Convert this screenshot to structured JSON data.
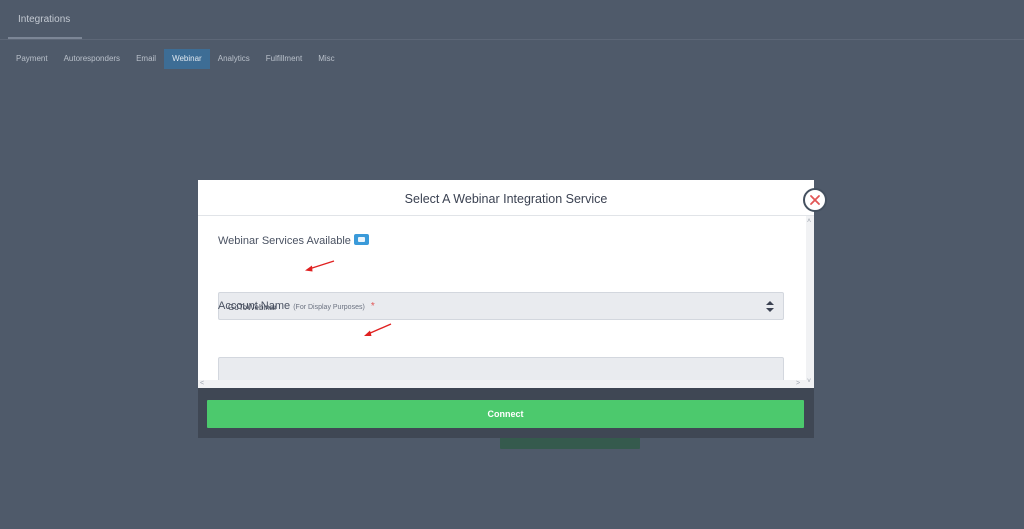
{
  "page": {
    "title": "Integrations",
    "tabs": [
      {
        "label": "Payment",
        "active": false
      },
      {
        "label": "Autoresponders",
        "active": false
      },
      {
        "label": "Email",
        "active": false
      },
      {
        "label": "Webinar",
        "active": true
      },
      {
        "label": "Analytics",
        "active": false
      },
      {
        "label": "Fulfillment",
        "active": false
      },
      {
        "label": "Misc",
        "active": false
      }
    ]
  },
  "modal": {
    "title": "Select A Webinar Integration Service",
    "services_label": "Webinar Services Available",
    "service_selected": "GoToWebinar",
    "account_label": "Account Name",
    "account_hint": "(For Display Purposes)",
    "required_mark": "*",
    "account_value": "",
    "connect_label": "Connect"
  },
  "icons": {
    "close": "close-icon",
    "info": "info-icon",
    "select_arrows": "select-arrows-icon",
    "annotation": "red-arrow-icon"
  },
  "colors": {
    "accent_green": "#4cc96d",
    "active_tab": "#3d6d95",
    "overlay": "#4f5a6a",
    "close_x": "#e25555",
    "annotation_red": "#e02020"
  }
}
